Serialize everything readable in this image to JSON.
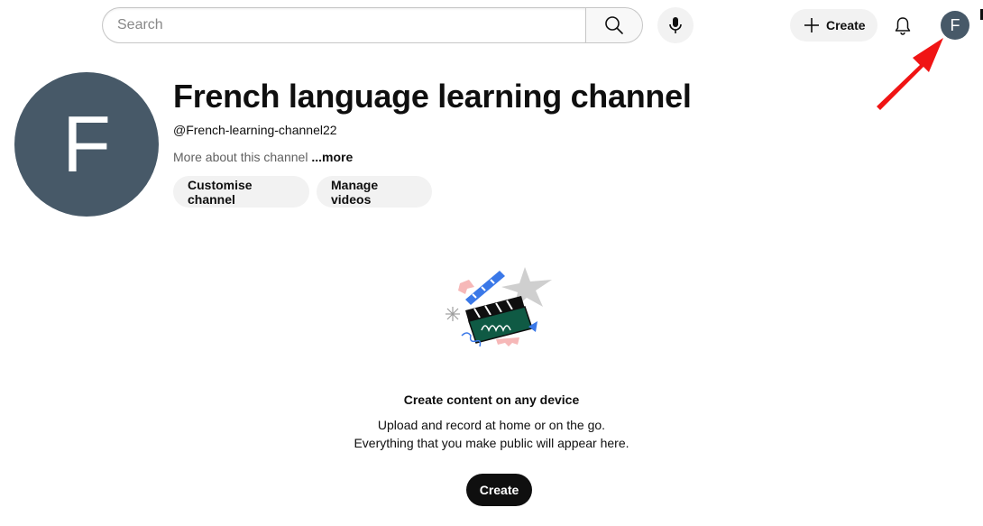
{
  "header": {
    "search_placeholder": "Search",
    "create_label": "Create",
    "account_initial": "F"
  },
  "channel": {
    "avatar_initial": "F",
    "avatar_color": "#475968",
    "title": "French language learning channel",
    "handle": "@French-learning-channel22",
    "about_text": "More about this channel",
    "more_label": "...more",
    "customise_label": "Customise channel",
    "manage_label": "Manage videos"
  },
  "empty_state": {
    "title": "Create content on any device",
    "line1": "Upload and record at home or on the go.",
    "line2": "Everything that you make public will appear here.",
    "create_label": "Create"
  },
  "annotation": {
    "arrow_color": "#f01414"
  }
}
